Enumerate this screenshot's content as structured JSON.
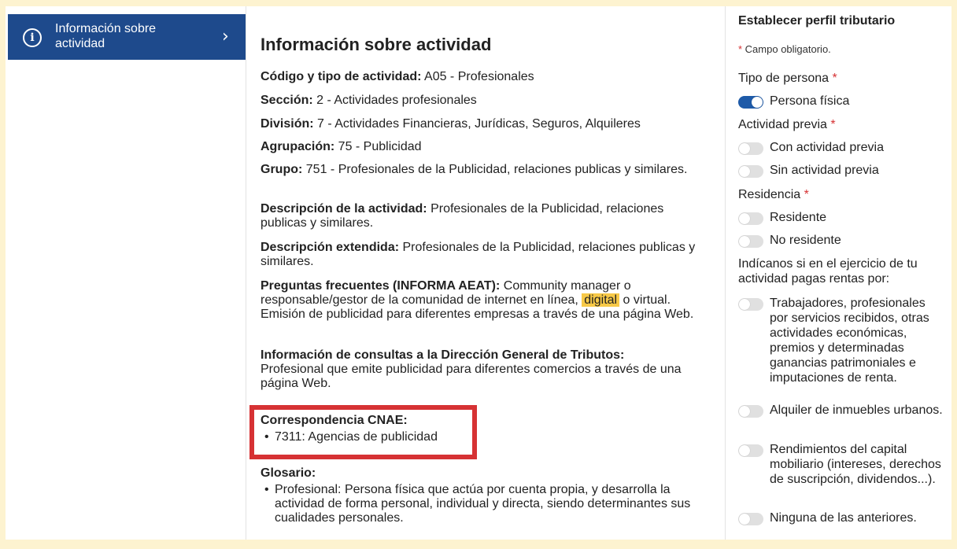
{
  "sidebar": {
    "item_label": "Información sobre actividad"
  },
  "main": {
    "title": "Información sobre actividad",
    "codigo": {
      "label": "Código y tipo de actividad:",
      "value": " A05 - Profesionales"
    },
    "seccion": {
      "label": "Sección:",
      "value": " 2 - Actividades profesionales"
    },
    "division": {
      "label": "División:",
      "value": " 7 - Actividades Financieras, Jurídicas, Seguros, Alquileres"
    },
    "agrupacion": {
      "label": "Agrupación:",
      "value": " 75 - Publicidad"
    },
    "grupo": {
      "label": "Grupo:",
      "value": " 751 - Profesionales de la Publicidad, relaciones publicas y similares."
    },
    "descripcion": {
      "label": "Descripción de la actividad:",
      "value": " Profesionales de la Publicidad, relaciones publicas y similares."
    },
    "descripcion_ext": {
      "label": "Descripción extendida:",
      "value": " Profesionales de la Publicidad, relaciones publicas y similares."
    },
    "preguntas": {
      "label": "Preguntas frecuentes (INFORMA AEAT):",
      "before": " Community manager o responsable/gestor de la comunidad de internet en línea, ",
      "highlight": "digital",
      "after": " o virtual. Emisión de publicidad para diferentes empresas a través de una página Web."
    },
    "consultas": {
      "label": "Información de consultas a la Dirección General de Tributos:",
      "value": "Profesional que emite publicidad para diferentes comercios a través de una página Web."
    },
    "cnae": {
      "label": "Correspondencia CNAE:",
      "items": [
        "7311: Agencias de publicidad"
      ]
    },
    "glosario": {
      "label": "Glosario:",
      "items": [
        "Profesional: Persona física que actúa por cuenta propia, y desarrolla la actividad de forma personal, individual y directa, siendo determinantes sus cualidades personales."
      ]
    }
  },
  "panel": {
    "title": "Establecer perfil tributario",
    "required_note": "Campo obligatorio.",
    "tipo_persona": {
      "label": "Tipo de persona",
      "options": [
        "Persona física"
      ]
    },
    "actividad_previa": {
      "label": "Actividad previa",
      "options": [
        "Con actividad previa",
        "Sin actividad previa"
      ]
    },
    "residencia": {
      "label": "Residencia",
      "options": [
        "Residente",
        "No residente"
      ]
    },
    "rentas": {
      "label": "Indícanos si en el ejercicio de tu actividad pagas rentas por:",
      "options": [
        "Trabajadores, profesionales por servicios recibidos, otras actividades económicas, premios y determinadas ganancias patrimoniales e imputaciones de renta.",
        "Alquiler de inmuebles urbanos.",
        "Rendimientos del capital mobiliario (intereses, derechos de suscripción, dividendos...).",
        "Ninguna de las anteriores."
      ]
    }
  },
  "colors": {
    "sidebar_active": "#1e4a8c",
    "highlight": "#f7c948",
    "annotation_box": "#d63234",
    "toggle_on": "#1e5aa8",
    "page_border": "#fdf3d0"
  }
}
